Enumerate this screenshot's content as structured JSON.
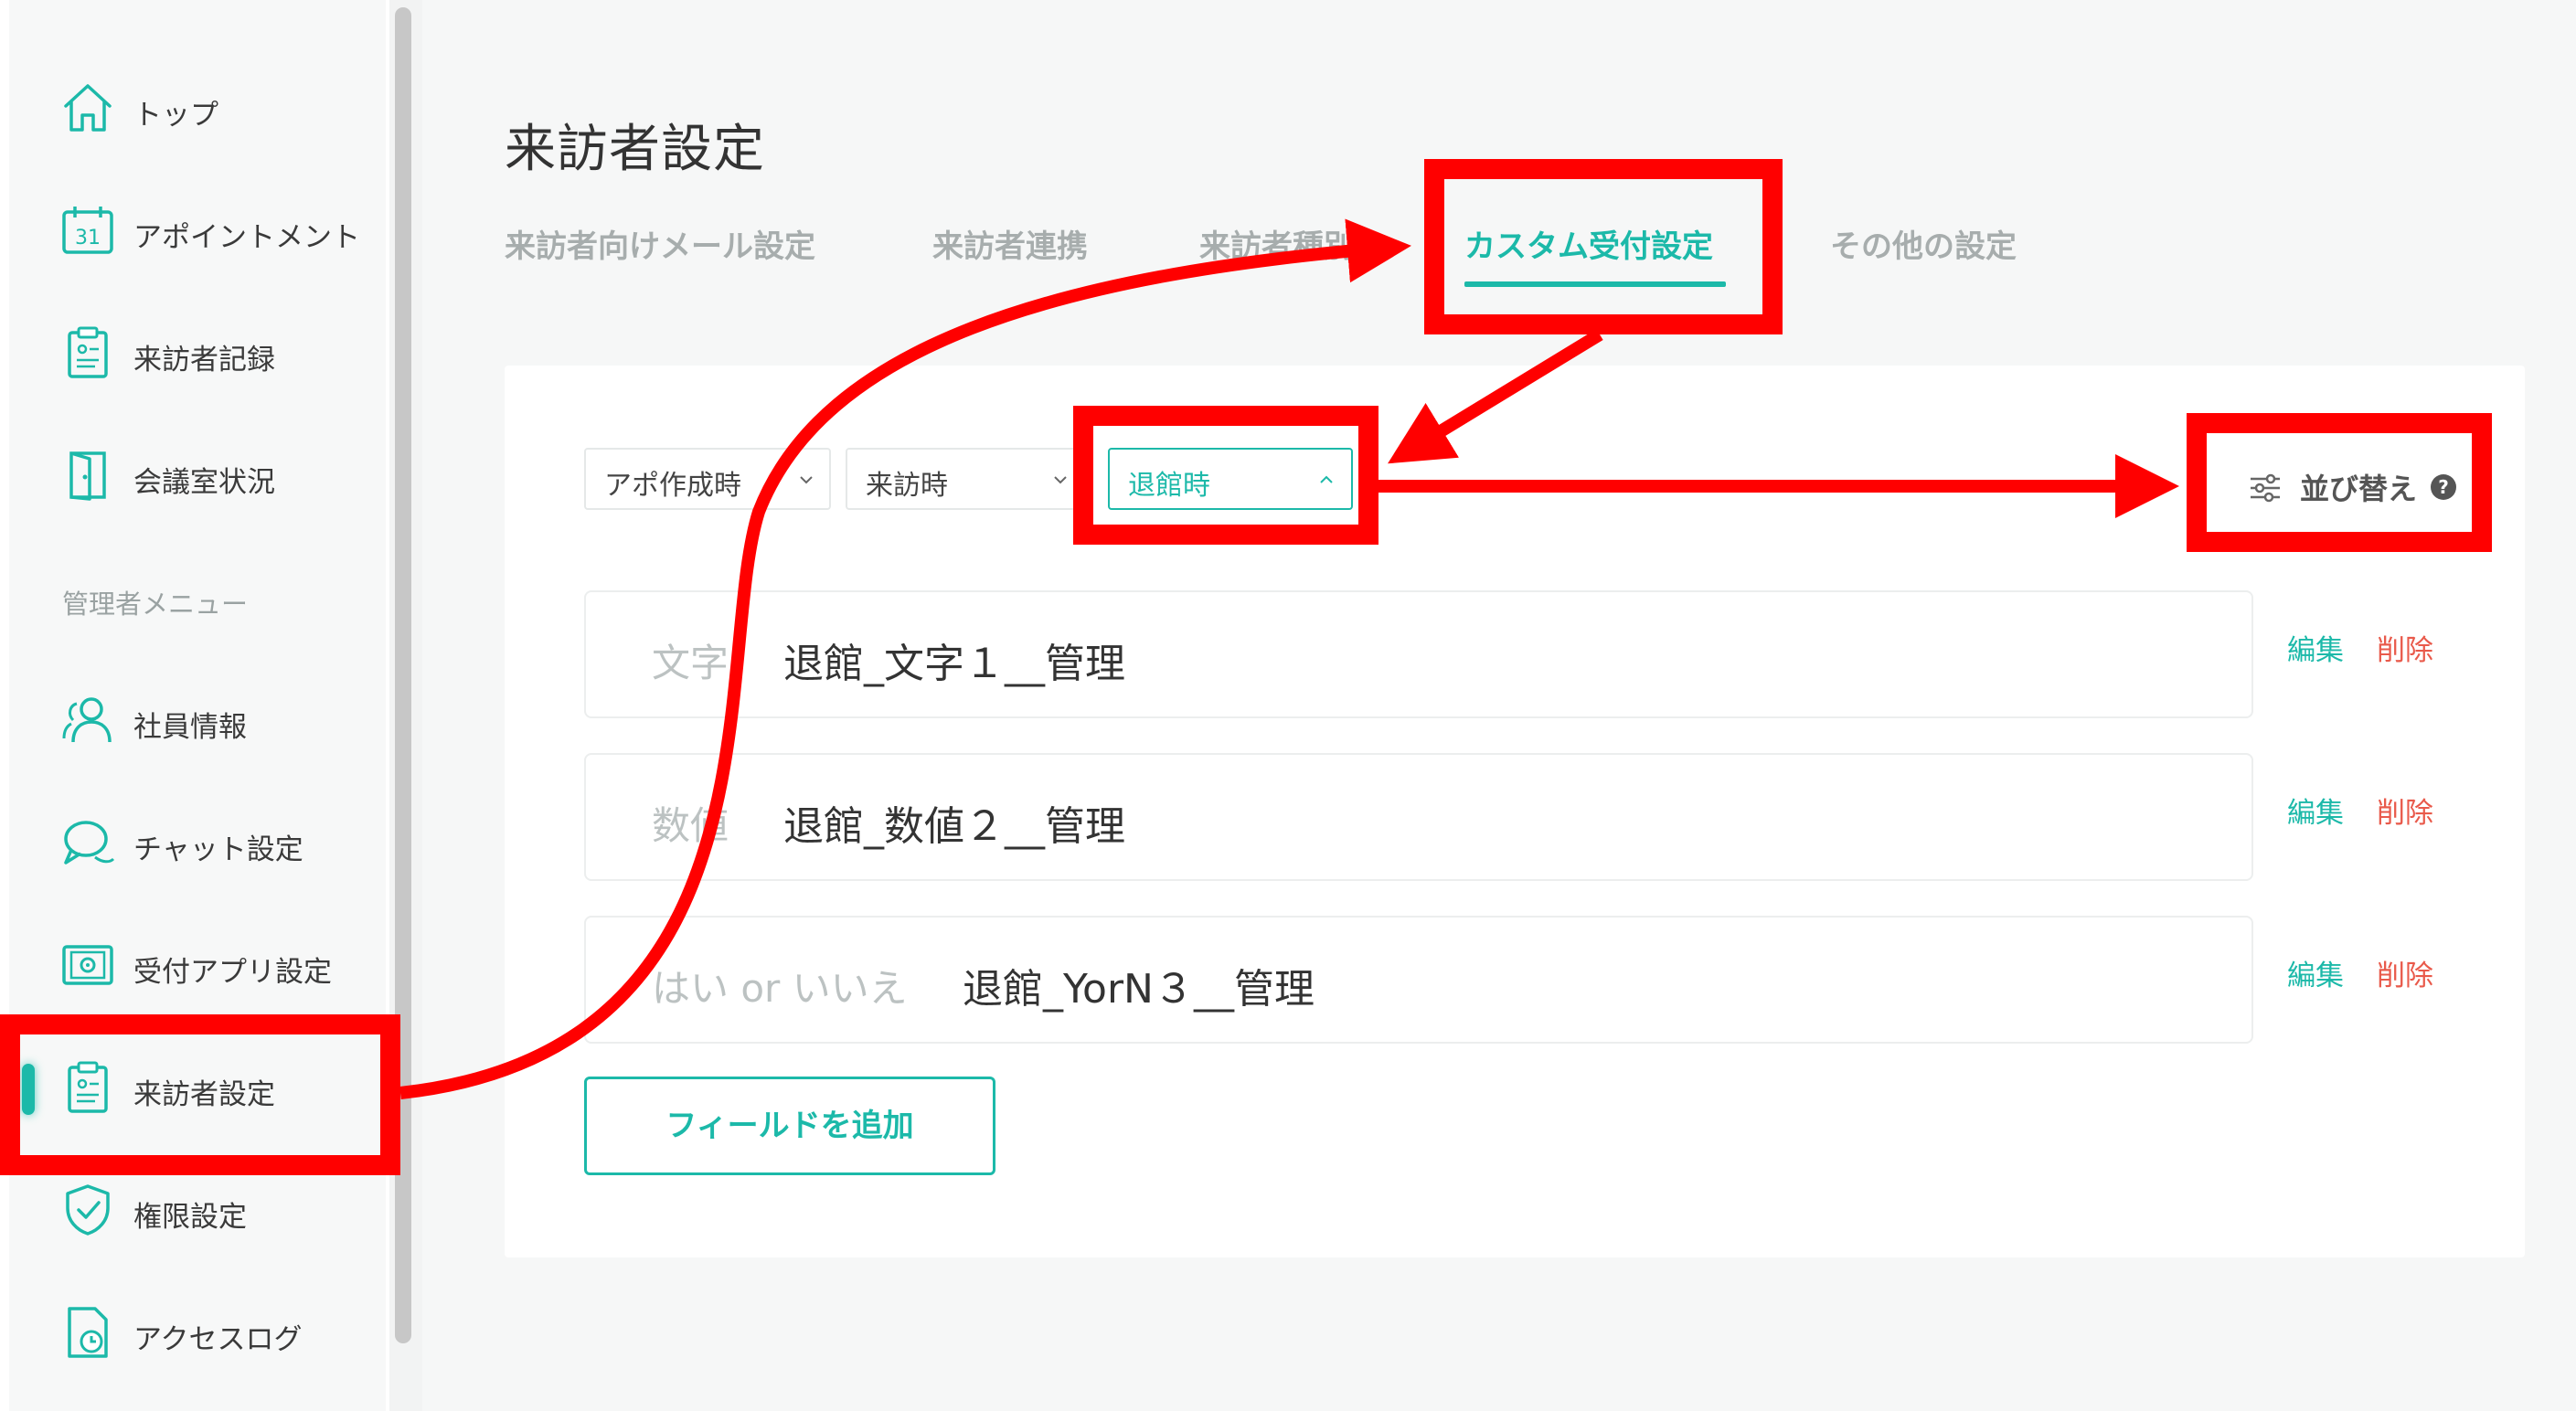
{
  "sidebar": {
    "items": [
      {
        "label": "トップ",
        "icon": "home-icon"
      },
      {
        "label": "アポイントメント",
        "icon": "calendar-icon",
        "icon_text": "31"
      },
      {
        "label": "来訪者記録",
        "icon": "clipboard-icon"
      },
      {
        "label": "会議室状況",
        "icon": "door-icon"
      }
    ],
    "admin_heading": "管理者メニュー",
    "admin_items": [
      {
        "label": "社員情報",
        "icon": "users-icon"
      },
      {
        "label": "チャット設定",
        "icon": "chat-icon"
      },
      {
        "label": "受付アプリ設定",
        "icon": "tablet-gear-icon"
      },
      {
        "label": "来訪者設定",
        "icon": "clipboard-icon",
        "active": true
      },
      {
        "label": "権限設定",
        "icon": "shield-check-icon"
      },
      {
        "label": "アクセスログ",
        "icon": "log-clock-icon"
      }
    ]
  },
  "page": {
    "title": "来訪者設定",
    "tabs": [
      {
        "label": "来訪者向けメール設定"
      },
      {
        "label": "来訪者連携"
      },
      {
        "label": "来訪者種別"
      },
      {
        "label": "カスタム受付設定",
        "active": true
      },
      {
        "label": "その他の設定"
      }
    ]
  },
  "filters": [
    {
      "label": "アポ作成時"
    },
    {
      "label": "来訪時"
    },
    {
      "label": "退館時",
      "open": true
    }
  ],
  "sort": {
    "label": "並び替え",
    "icon": "sliders-icon",
    "help_icon": "question-circle-icon"
  },
  "fields": [
    {
      "type": "文字",
      "name": "退館_文字１__管理",
      "edit": "編集",
      "delete": "削除"
    },
    {
      "type": "数値",
      "name": "退館_数値２__管理",
      "edit": "編集",
      "delete": "削除"
    },
    {
      "type": "はい or いいえ",
      "name": "退館_YorN３__管理",
      "edit": "編集",
      "delete": "削除"
    }
  ],
  "add_field_label": "フィールドを追加",
  "colors": {
    "accent": "#1cb9a9",
    "delete": "#e95a4b",
    "annotation": "#ff0000"
  }
}
